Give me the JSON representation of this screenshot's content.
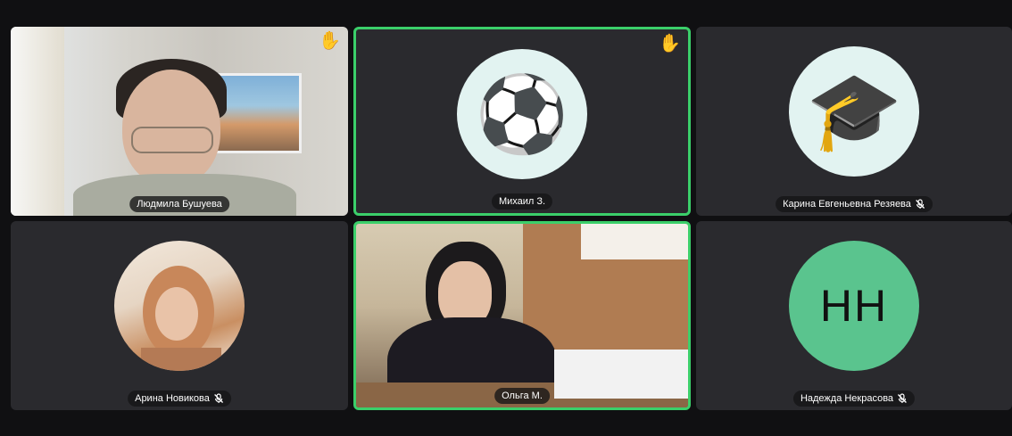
{
  "participants": [
    {
      "name": "Людмила Бушуева",
      "muted": false,
      "hand_raised": true,
      "speaking": false,
      "view": "video"
    },
    {
      "name": "Михаил З.",
      "muted": false,
      "hand_raised": true,
      "speaking": true,
      "view": "avatar-soccer-ball"
    },
    {
      "name": "Карина Евгеньевна Резяева",
      "muted": true,
      "hand_raised": false,
      "speaking": false,
      "view": "avatar-graduation-cap"
    },
    {
      "name": "Арина Новикова",
      "muted": true,
      "hand_raised": false,
      "speaking": false,
      "view": "avatar-photo"
    },
    {
      "name": "Ольга М.",
      "muted": false,
      "hand_raised": false,
      "speaking": true,
      "view": "video"
    },
    {
      "name": "Надежда Некрасова",
      "muted": true,
      "hand_raised": false,
      "speaking": false,
      "view": "avatar-initials",
      "initials": "НН"
    }
  ],
  "icons": {
    "hand": "✋",
    "soccer_ball": "⚽",
    "graduation_cap": "🎓"
  },
  "colors": {
    "speaking_border": "#3bcf6a",
    "tile_bg": "#2a2a2e",
    "initials_avatar": "#5ac48e"
  }
}
